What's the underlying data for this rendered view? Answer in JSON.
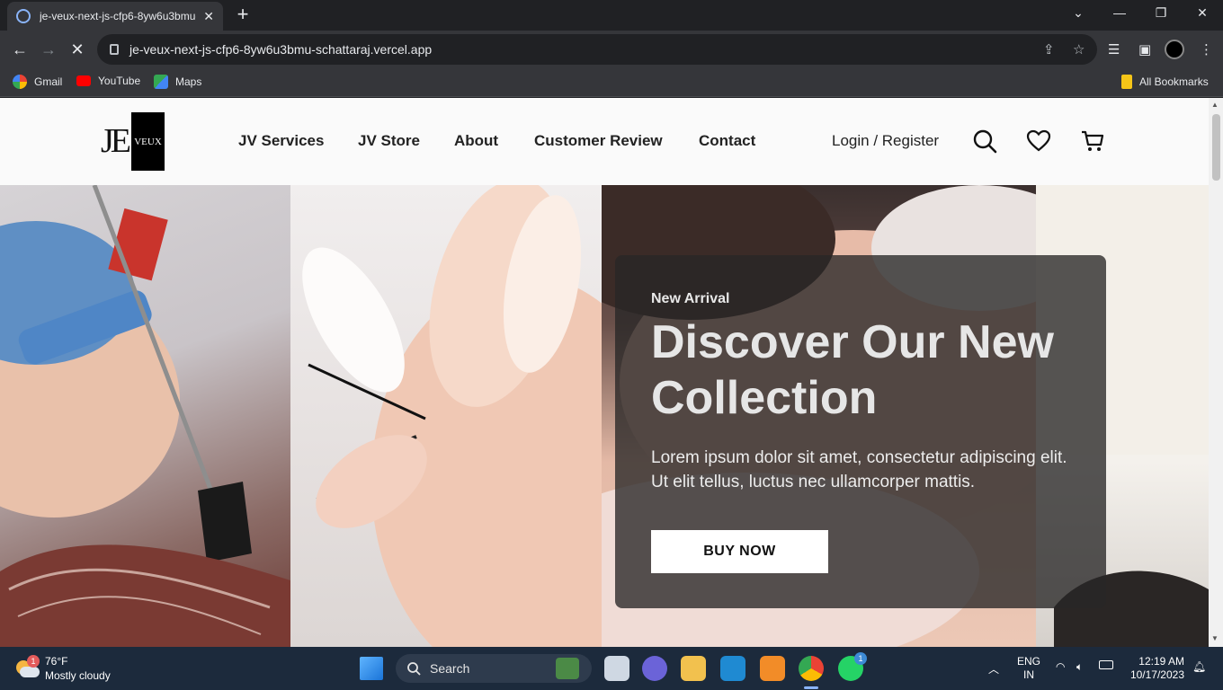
{
  "browser": {
    "tab_title": "je-veux-next-js-cfp6-8yw6u3bmu-schattaraj.vercel.app",
    "tab_close": "✕",
    "new_tab": "+",
    "url": "je-veux-next-js-cfp6-8yw6u3bmu-schattaraj.vercel.app",
    "bookmarks": [
      "Gmail",
      "YouTube",
      "Maps"
    ],
    "all_bookmarks": "All Bookmarks"
  },
  "site": {
    "logo_text": "JE",
    "logo_box_text": "VEUX",
    "nav": [
      "JV Services",
      "JV Store",
      "About",
      "Customer Review",
      "Contact"
    ],
    "login": "Login / Register"
  },
  "hero": {
    "eyebrow": "New Arrival",
    "title": "Discover Our New Collection",
    "description": "Lorem ipsum dolor sit amet, consectetur adipiscing elit. Ut elit tellus, luctus nec ullamcorper mattis.",
    "cta": "BUY NOW"
  },
  "taskbar": {
    "weather_temp": "76°F",
    "weather_desc": "Mostly cloudy",
    "weather_badge": "1",
    "search_label": "Search",
    "whatsapp_badge": "1",
    "lang_top": "ENG",
    "lang_bottom": "IN",
    "time": "12:19 AM",
    "date": "10/17/2023"
  },
  "colors": {
    "chrome_dark": "#202124",
    "chrome_toolbar": "#35363a",
    "taskbar": "#1c2a3c",
    "card_overlay": "rgba(40,38,38,0.78)"
  }
}
